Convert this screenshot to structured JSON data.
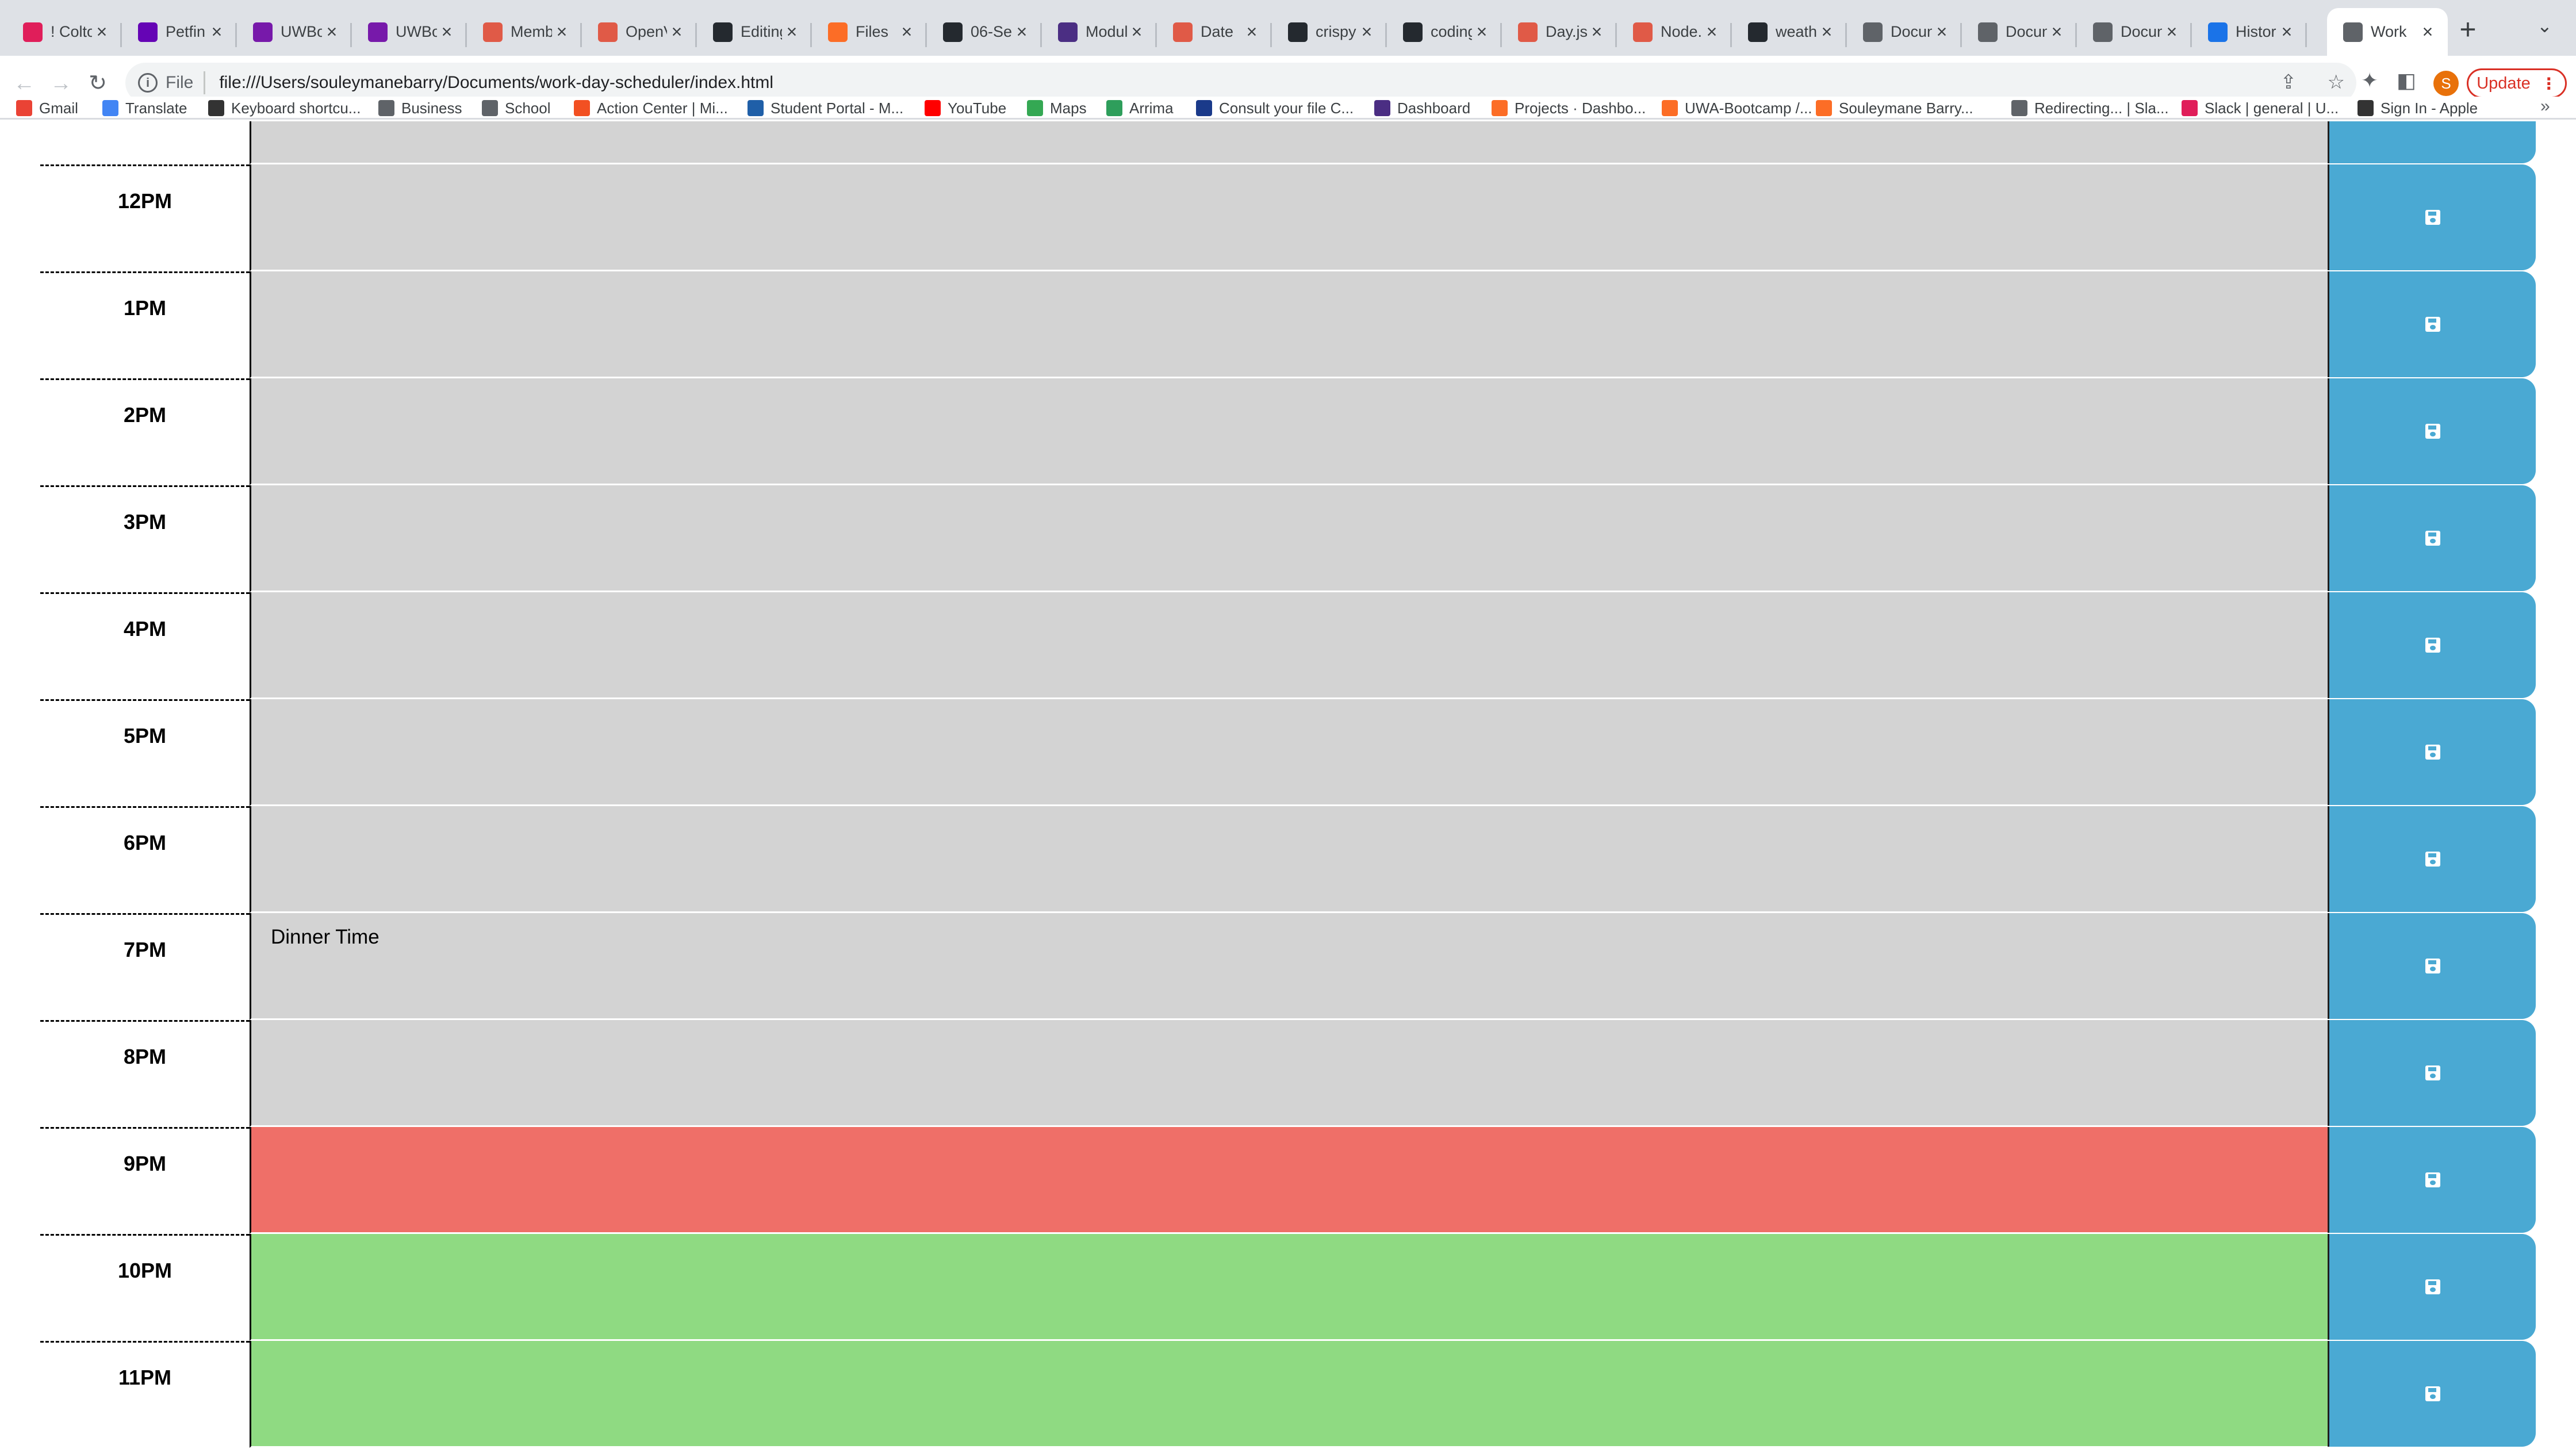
{
  "browser": {
    "tabs": [
      {
        "title": "! Colto",
        "favicon": "slack-icon",
        "color": "#e01e5a"
      },
      {
        "title": "Petfin",
        "favicon": "petfinder-icon",
        "color": "#6504b5"
      },
      {
        "title": "UWBo",
        "favicon": "onenote-icon",
        "color": "#7719aa"
      },
      {
        "title": "UWBo",
        "favicon": "onenote-icon",
        "color": "#7719aa"
      },
      {
        "title": "Memb",
        "favicon": "brain-icon",
        "color": "#e05a47"
      },
      {
        "title": "OpenV",
        "favicon": "brain-icon",
        "color": "#e05a47"
      },
      {
        "title": "Editing",
        "favicon": "github-icon",
        "color": "#24292f"
      },
      {
        "title": "Files",
        "favicon": "gitlab-icon",
        "color": "#fc6d26"
      },
      {
        "title": "06-Se",
        "favicon": "github-icon",
        "color": "#24292f"
      },
      {
        "title": "Modul",
        "favicon": "uw-icon",
        "color": "#4b2e83"
      },
      {
        "title": "Date",
        "favicon": "mdn-icon",
        "color": "#e05a47"
      },
      {
        "title": "crispy",
        "favicon": "github-icon",
        "color": "#24292f"
      },
      {
        "title": "coding",
        "favicon": "github-icon",
        "color": "#24292f"
      },
      {
        "title": "Day.js",
        "favicon": "mdn-icon",
        "color": "#e05a47"
      },
      {
        "title": "Node.",
        "favicon": "mdn-icon",
        "color": "#e05a47"
      },
      {
        "title": "weath",
        "favicon": "github-icon",
        "color": "#24292f"
      },
      {
        "title": "Docun",
        "favicon": "globe-icon",
        "color": "#5f6368"
      },
      {
        "title": "Docun",
        "favicon": "globe-icon",
        "color": "#5f6368"
      },
      {
        "title": "Docun",
        "favicon": "globe-icon",
        "color": "#5f6368"
      },
      {
        "title": "Histor",
        "favicon": "history-icon",
        "color": "#1a73e8"
      },
      {
        "title": "Work",
        "favicon": "globe-icon",
        "color": "#5f6368",
        "active": true
      }
    ],
    "new_tab": "+",
    "address": {
      "scheme_label": "File",
      "url": "file:///Users/souleymanebarry/Documents/work-day-scheduler/index.html"
    },
    "profile_initial": "S",
    "update_label": "Update",
    "bookmarks": [
      {
        "label": "Gmail",
        "icon": "gmail-icon",
        "color": "#ea4335"
      },
      {
        "label": "Translate",
        "icon": "translate-icon",
        "color": "#4285f4"
      },
      {
        "label": "Keyboard shortcu...",
        "icon": "apple-icon",
        "color": "#333333"
      },
      {
        "label": "Business",
        "icon": "folder-icon",
        "color": "#5f6368"
      },
      {
        "label": "School",
        "icon": "folder-icon",
        "color": "#5f6368"
      },
      {
        "label": "Action Center | Mi...",
        "icon": "microsoft-icon",
        "color": "#f25022"
      },
      {
        "label": "Student Portal - M...",
        "icon": "portal-icon",
        "color": "#1f5fa8"
      },
      {
        "label": "YouTube",
        "icon": "youtube-icon",
        "color": "#ff0000"
      },
      {
        "label": "Maps",
        "icon": "maps-icon",
        "color": "#34a853"
      },
      {
        "label": "Arrima",
        "icon": "arrima-icon",
        "color": "#2e9e5b"
      },
      {
        "label": "Consult your file C...",
        "icon": "canada-icon",
        "color": "#1a3a8a"
      },
      {
        "label": "Dashboard",
        "icon": "uw-icon",
        "color": "#4b2e83"
      },
      {
        "label": "Projects · Dashbo...",
        "icon": "gitlab-icon",
        "color": "#fc6d26"
      },
      {
        "label": "UWA-Bootcamp /...",
        "icon": "gitlab-icon",
        "color": "#fc6d26"
      },
      {
        "label": "Souleymane Barry...",
        "icon": "gitlab-icon",
        "color": "#fc6d26"
      },
      {
        "label": "Redirecting... | Sla...",
        "icon": "globe-icon",
        "color": "#5f6368"
      },
      {
        "label": "Slack | general | U...",
        "icon": "slack-icon",
        "color": "#e01e5a"
      },
      {
        "label": "Sign In - Apple",
        "icon": "apple-icon",
        "color": "#333333"
      }
    ]
  },
  "scheduler": {
    "hours": [
      {
        "label": "",
        "text": "",
        "state": "past"
      },
      {
        "label": "12PM",
        "text": "",
        "state": "past"
      },
      {
        "label": "1PM",
        "text": "",
        "state": "past"
      },
      {
        "label": "2PM",
        "text": "",
        "state": "past"
      },
      {
        "label": "3PM",
        "text": "",
        "state": "past"
      },
      {
        "label": "4PM",
        "text": "",
        "state": "past"
      },
      {
        "label": "5PM",
        "text": "",
        "state": "past"
      },
      {
        "label": "6PM",
        "text": "",
        "state": "past"
      },
      {
        "label": "7PM",
        "text": "Dinner Time",
        "state": "past"
      },
      {
        "label": "8PM",
        "text": "",
        "state": "past"
      },
      {
        "label": "9PM",
        "text": "",
        "state": "present"
      },
      {
        "label": "10PM",
        "text": "",
        "state": "future"
      },
      {
        "label": "11PM",
        "text": "",
        "state": "future"
      }
    ],
    "colors": {
      "past": "#d3d3d3",
      "present": "#ef6f68",
      "future": "#8fda82",
      "save": "#4aa9d3"
    }
  }
}
